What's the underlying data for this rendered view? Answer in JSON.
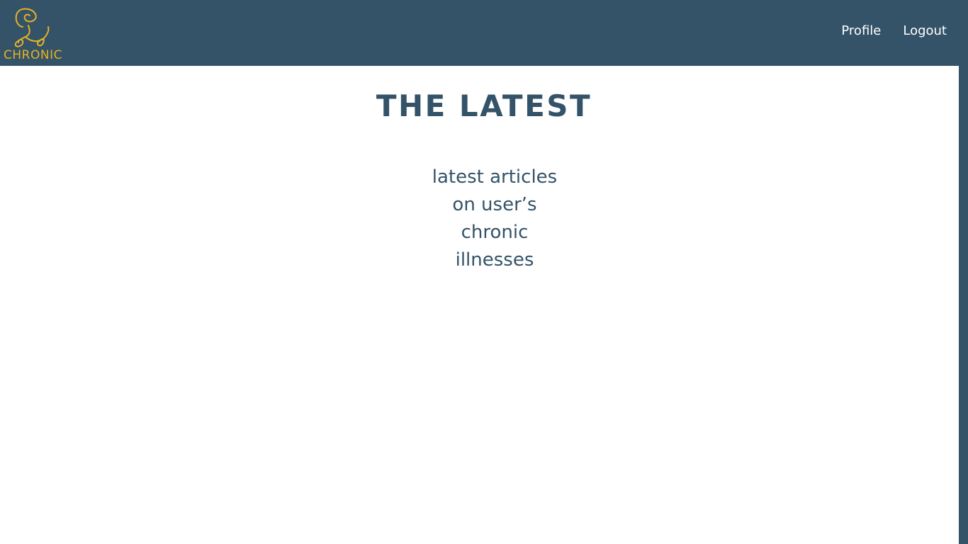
{
  "colors": {
    "primary": "#345368",
    "accent": "#E5B323",
    "background": "#FFFFFF",
    "nav_text": "#FFFFFF"
  },
  "logo": {
    "text": "CHRONIC",
    "icon": "chronic-logo-icon"
  },
  "nav": {
    "profile_label": "Profile",
    "logout_label": "Logout"
  },
  "main": {
    "title": "THE LATEST",
    "placeholder_lines": [
      "latest articles",
      "on user’s",
      "chronic",
      "illnesses"
    ]
  }
}
